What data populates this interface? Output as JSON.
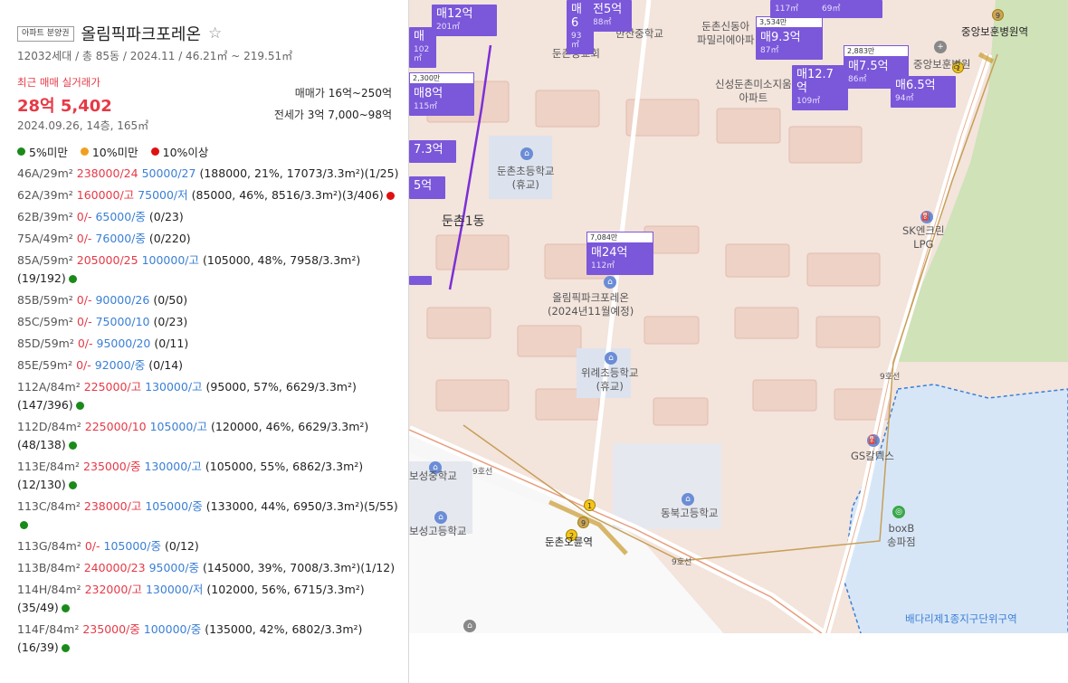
{
  "header": {
    "badge": "아파트 분양권",
    "name": "올림픽파크포레온",
    "star": "☆",
    "summary": "12032세대 / 총 85동 / 2024.11 / 46.21㎡ ~ 219.51㎡"
  },
  "recent": {
    "label": "최근 매매 실거래가",
    "price": "28억 5,402",
    "date": "2024.09.26, 14층, 165㎡",
    "sale_label": "매매가",
    "sale_range": "16억~250억",
    "jeonse_label": "전세가",
    "jeonse_range": "3억 7,000~98억"
  },
  "legend": [
    {
      "label": "5%미만",
      "color": "#1a8a1a"
    },
    {
      "label": "10%미만",
      "color": "#f0a020"
    },
    {
      "label": "10%이상",
      "color": "#e01010"
    }
  ],
  "rows": [
    {
      "type": "46A/29m²",
      "sale": "238000/24",
      "jeonse": "50000/27",
      "stats": "(188000, 21%, 17073/3.3m²)(1/25)",
      "dot": ""
    },
    {
      "type": "62A/39m²",
      "sale": "160000/고",
      "jeonse": "75000/저",
      "stats": "(85000, 46%, 8516/3.3m²)(3/406)",
      "dot": "#e01010"
    },
    {
      "type": "62B/39m²",
      "sale": "0/-",
      "jeonse": "65000/중",
      "stats": "(0/23)",
      "dot": ""
    },
    {
      "type": "75A/49m²",
      "sale": "0/-",
      "jeonse": "76000/중",
      "stats": "(0/220)",
      "dot": ""
    },
    {
      "type": "85A/59m²",
      "sale": "205000/25",
      "jeonse": "100000/고",
      "stats": "(105000, 48%, 7958/3.3m²)(19/192)",
      "dot": "#1a8a1a"
    },
    {
      "type": "85B/59m²",
      "sale": "0/-",
      "jeonse": "90000/26",
      "stats": "(0/50)",
      "dot": ""
    },
    {
      "type": "85C/59m²",
      "sale": "0/-",
      "jeonse": "75000/10",
      "stats": "(0/23)",
      "dot": ""
    },
    {
      "type": "85D/59m²",
      "sale": "0/-",
      "jeonse": "95000/20",
      "stats": "(0/11)",
      "dot": ""
    },
    {
      "type": "85E/59m²",
      "sale": "0/-",
      "jeonse": "92000/중",
      "stats": "(0/14)",
      "dot": ""
    },
    {
      "type": "112A/84m²",
      "sale": "225000/고",
      "jeonse": "130000/고",
      "stats": "(95000, 57%, 6629/3.3m²)(147/396)",
      "dot": "#1a8a1a"
    },
    {
      "type": "112D/84m²",
      "sale": "225000/10",
      "jeonse": "105000/고",
      "stats": "(120000, 46%, 6629/3.3m²)(48/138)",
      "dot": "#1a8a1a"
    },
    {
      "type": "113E/84m²",
      "sale": "235000/중",
      "jeonse": "130000/고",
      "stats": "(105000, 55%, 6862/3.3m²)(12/130)",
      "dot": "#1a8a1a"
    },
    {
      "type": "113C/84m²",
      "sale": "238000/고",
      "jeonse": "105000/중",
      "stats": "(133000, 44%, 6950/3.3m²)(5/55)",
      "dot": "#1a8a1a"
    },
    {
      "type": "113G/84m²",
      "sale": "0/-",
      "jeonse": "105000/중",
      "stats": "(0/12)",
      "dot": ""
    },
    {
      "type": "113B/84m²",
      "sale": "240000/23",
      "jeonse": "95000/중",
      "stats": "(145000, 39%, 7008/3.3m²)(1/12)",
      "dot": ""
    },
    {
      "type": "114H/84m²",
      "sale": "232000/고",
      "jeonse": "130000/저",
      "stats": "(102000, 56%, 6715/3.3m²)(35/49)",
      "dot": "#1a8a1a"
    },
    {
      "type": "114F/84m²",
      "sale": "235000/중",
      "jeonse": "100000/중",
      "stats": "(135000, 42%, 6802/3.3m²)(16/39)",
      "dot": "#1a8a1a"
    }
  ],
  "map": {
    "labels": [
      {
        "text": "둔촌1동",
        "cls": "big"
      },
      {
        "text": "둔촌초등학교\n(휴교)",
        "cls": ""
      },
      {
        "text": "올림픽파크포레온\n(2024년11월예정)",
        "cls": ""
      },
      {
        "text": "위례초등학교\n(휴교)",
        "cls": ""
      },
      {
        "text": "동북고등학교",
        "cls": ""
      },
      {
        "text": "보성중학교",
        "cls": ""
      },
      {
        "text": "보성고등학교",
        "cls": ""
      },
      {
        "text": "둔촌오륜역",
        "cls": "bold"
      },
      {
        "text": "SK엔크린\nLPG",
        "cls": ""
      },
      {
        "text": "GS칼텍스",
        "cls": ""
      },
      {
        "text": "boxB\n송파점",
        "cls": ""
      },
      {
        "text": "배다리제1종지구단위구역",
        "cls": "blue"
      },
      {
        "text": "중앙보훈병원역",
        "cls": "bold"
      },
      {
        "text": "중앙보훈병원",
        "cls": ""
      },
      {
        "text": "신성둔촌미소지움\n아파트",
        "cls": ""
      },
      {
        "text": "둔촌신동아\n파밀리에아파",
        "cls": ""
      },
      {
        "text": "한산중학교",
        "cls": ""
      },
      {
        "text": "둔촌동교회",
        "cls": ""
      },
      {
        "text": "9호선",
        "cls": ""
      },
      {
        "text": "9호선",
        "cls": ""
      },
      {
        "text": "9호선",
        "cls": ""
      }
    ],
    "markers": [
      {
        "top": "",
        "price": "매12억",
        "area": "201㎡"
      },
      {
        "top": "",
        "price": "매",
        "area": "102㎡"
      },
      {
        "top": "2,300만",
        "price": "매8억",
        "area": "115㎡"
      },
      {
        "top": "",
        "price": "7.3억",
        "area": ""
      },
      {
        "top": "",
        "price": "5억",
        "area": ""
      },
      {
        "top": "",
        "price": "",
        "area": ""
      },
      {
        "top": "",
        "price": "전5억",
        "area": "88㎡"
      },
      {
        "top": "",
        "price": "매6",
        "area": "93㎡"
      },
      {
        "top": "7,084만",
        "price": "매24억",
        "area": "112㎡"
      },
      {
        "top": "3,534만",
        "price": "매9.3억",
        "area": "87㎡"
      },
      {
        "top": "",
        "price": "매12.7억",
        "area": "109㎡"
      },
      {
        "top": "2,883만",
        "price": "매7.5억",
        "area": "86㎡"
      },
      {
        "top": "",
        "price": "매6.5억",
        "area": "94㎡"
      },
      {
        "top": "",
        "price": "",
        "area": "117㎡"
      },
      {
        "top": "",
        "price": "",
        "area": "69㎡"
      }
    ]
  }
}
